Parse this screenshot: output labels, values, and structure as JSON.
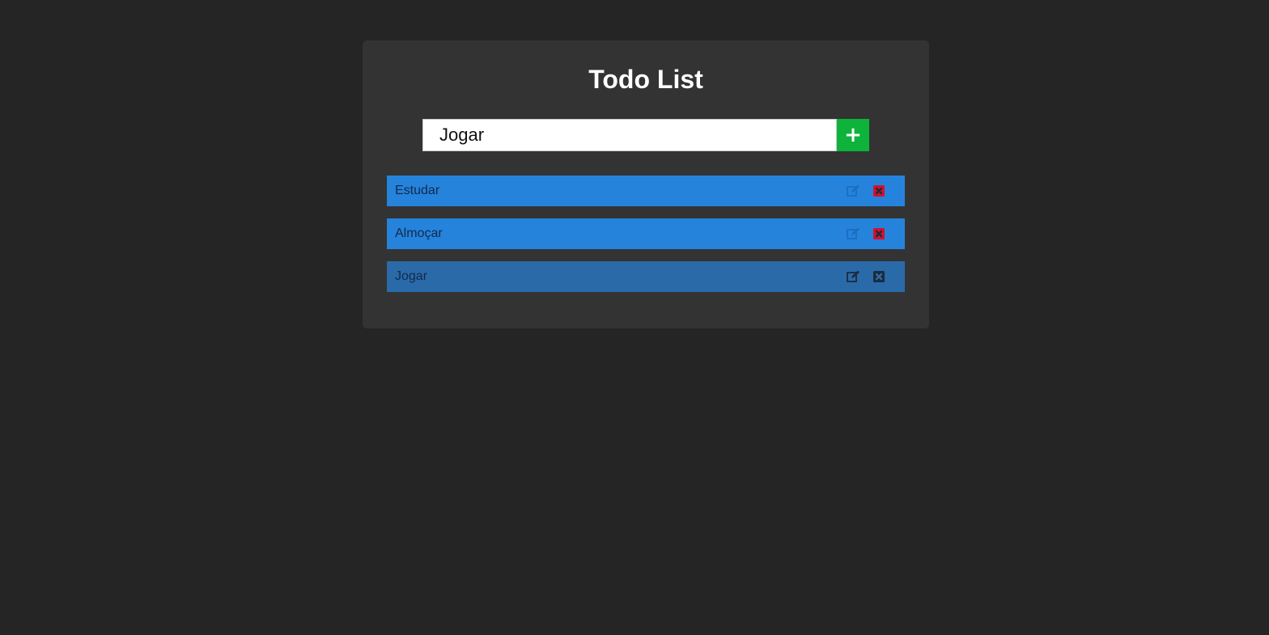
{
  "app": {
    "title": "Todo List"
  },
  "form": {
    "input_value": "Jogar",
    "add_label": "+"
  },
  "todos": [
    {
      "text": "Estudar",
      "active": false
    },
    {
      "text": "Almoçar",
      "active": false
    },
    {
      "text": "Jogar",
      "active": true
    }
  ],
  "icons": {
    "edit": "edit-icon",
    "delete": "delete-icon"
  },
  "colors": {
    "background": "#252525",
    "card": "#333333",
    "item": "#2583dc",
    "item_active": "#2a6aa9",
    "add_button": "#0db33a",
    "delete_icon": "#d6102e",
    "edit_icon": "#1c6ec0",
    "active_icon": "#1d2b3a"
  }
}
